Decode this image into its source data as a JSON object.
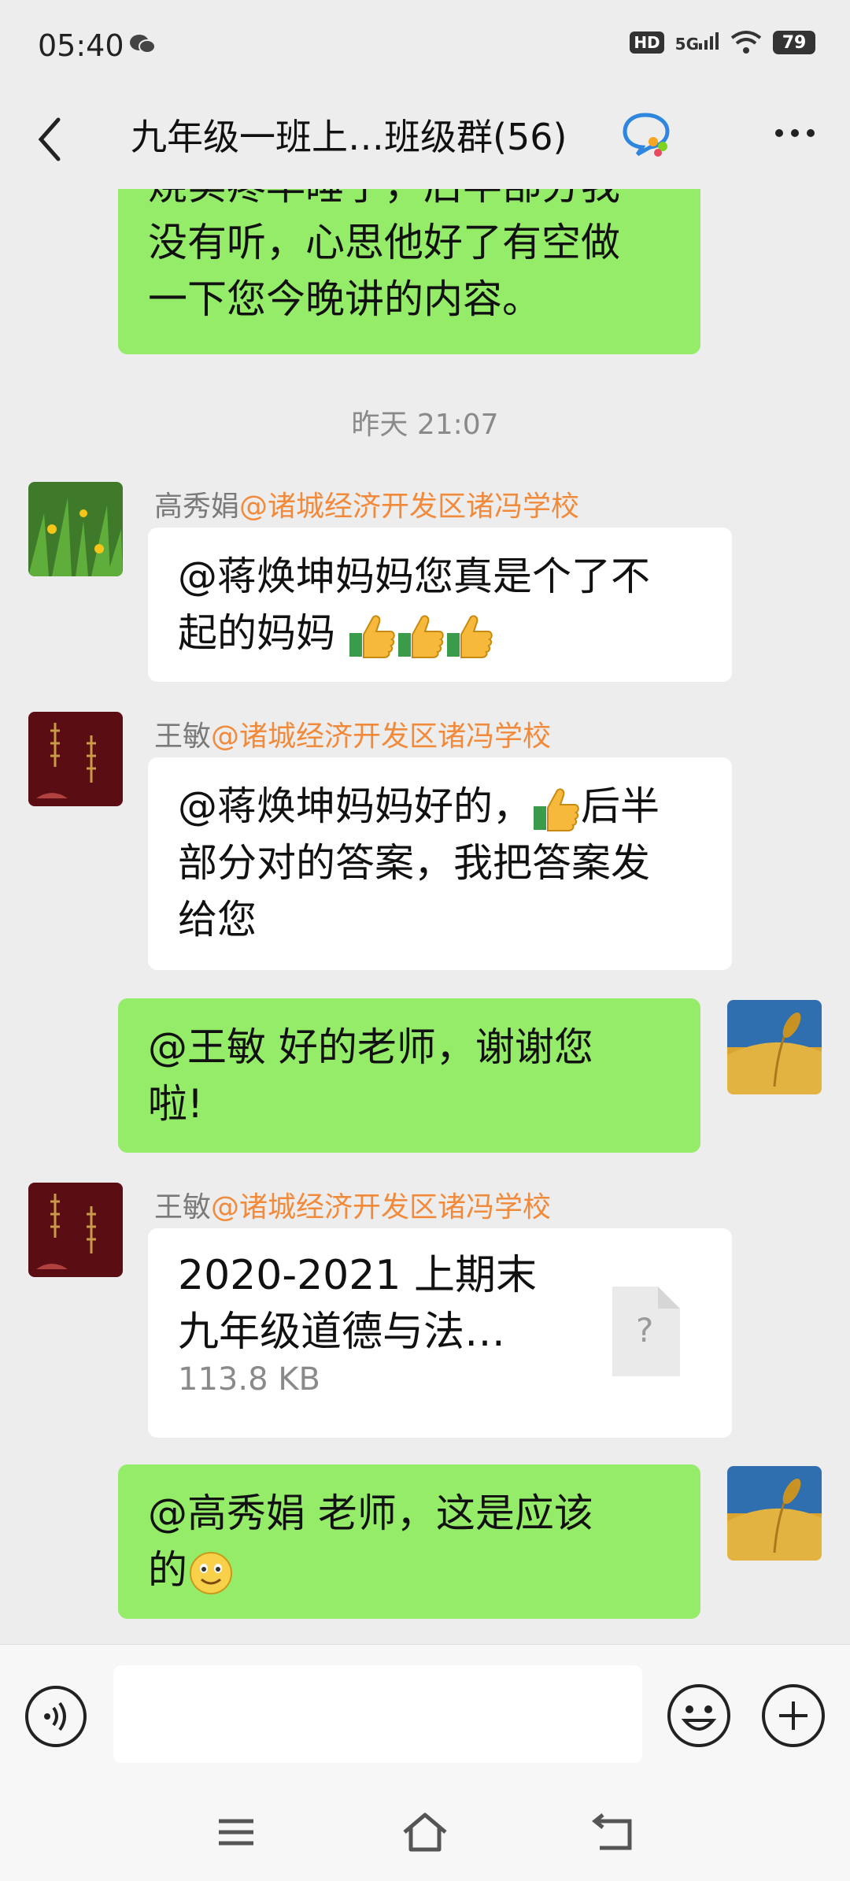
{
  "status": {
    "time": "05:40",
    "hd": "HD",
    "network": "5G",
    "battery": "79"
  },
  "header": {
    "title": "九年级一班上…班级群(56)"
  },
  "messages": {
    "m1": {
      "line1": "烧实疼早睡了，后半部分我",
      "line2": "没有听，心思他好了有空做",
      "line3": "一下您今晚讲的内容。"
    },
    "time": "昨天 21:07",
    "m2": {
      "sender_name": "高秀娟",
      "sender_school": "@诸城经济开发区诸冯学校",
      "line1": "@蒋焕坤妈妈您真是个了不",
      "line2": "起的妈妈"
    },
    "m3": {
      "sender_name": "王敏",
      "sender_school": "@诸城经济开发区诸冯学校",
      "line1a": "@蒋焕坤妈妈好的，",
      "line1b": "后半",
      "line2": "部分对的答案，我把答案发",
      "line3": "给您"
    },
    "m4": {
      "line1": "@王敏  好的老师，谢谢您",
      "line2": "啦!"
    },
    "m5": {
      "sender_name": "王敏",
      "sender_school": "@诸城经济开发区诸冯学校",
      "file_line1": "2020-2021 上期末",
      "file_line2": "九年级道德与法…",
      "file_size": "113.8 KB",
      "file_icon_char": "?"
    },
    "m6": {
      "line1": "@高秀娟  老师，这是应该",
      "line2": "的"
    }
  },
  "colors": {
    "bg": "#ededed",
    "bubble_green": "#95ec69",
    "school_tag": "#f28a3c"
  }
}
